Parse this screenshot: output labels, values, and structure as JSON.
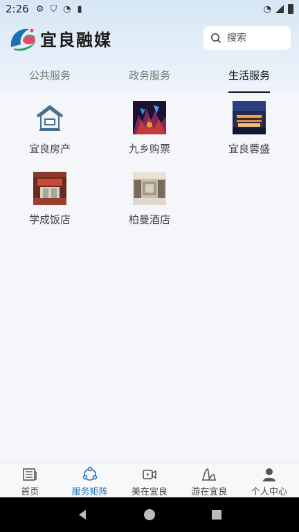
{
  "status_bar": {
    "time": "2:26"
  },
  "header": {
    "app_name": "宜良融媒",
    "search": {
      "placeholder": "搜索"
    }
  },
  "tabs": [
    {
      "label": "公共服务",
      "active": false
    },
    {
      "label": "政务服务",
      "active": false
    },
    {
      "label": "生活服务",
      "active": true
    }
  ],
  "services": [
    {
      "label": "宜良房产",
      "icon": "house-icon"
    },
    {
      "label": "九乡购票",
      "icon": "cave-photo"
    },
    {
      "label": "宜良蓉盛",
      "icon": "building-night-photo"
    },
    {
      "label": "学成饭店",
      "icon": "restaurant-photo"
    },
    {
      "label": "柏曼酒店",
      "icon": "hotel-lobby-photo"
    }
  ],
  "bottom_nav": [
    {
      "label": "首页",
      "icon": "newspaper-icon",
      "active": false
    },
    {
      "label": "服务矩阵",
      "icon": "matrix-icon",
      "active": true
    },
    {
      "label": "美在宜良",
      "icon": "video-icon",
      "active": false
    },
    {
      "label": "游在宜良",
      "icon": "mountain-icon",
      "active": false
    },
    {
      "label": "个人中心",
      "icon": "person-icon",
      "active": false
    }
  ],
  "colors": {
    "accent": "#1e6fb3",
    "header_bg": "#d6e6f5"
  }
}
